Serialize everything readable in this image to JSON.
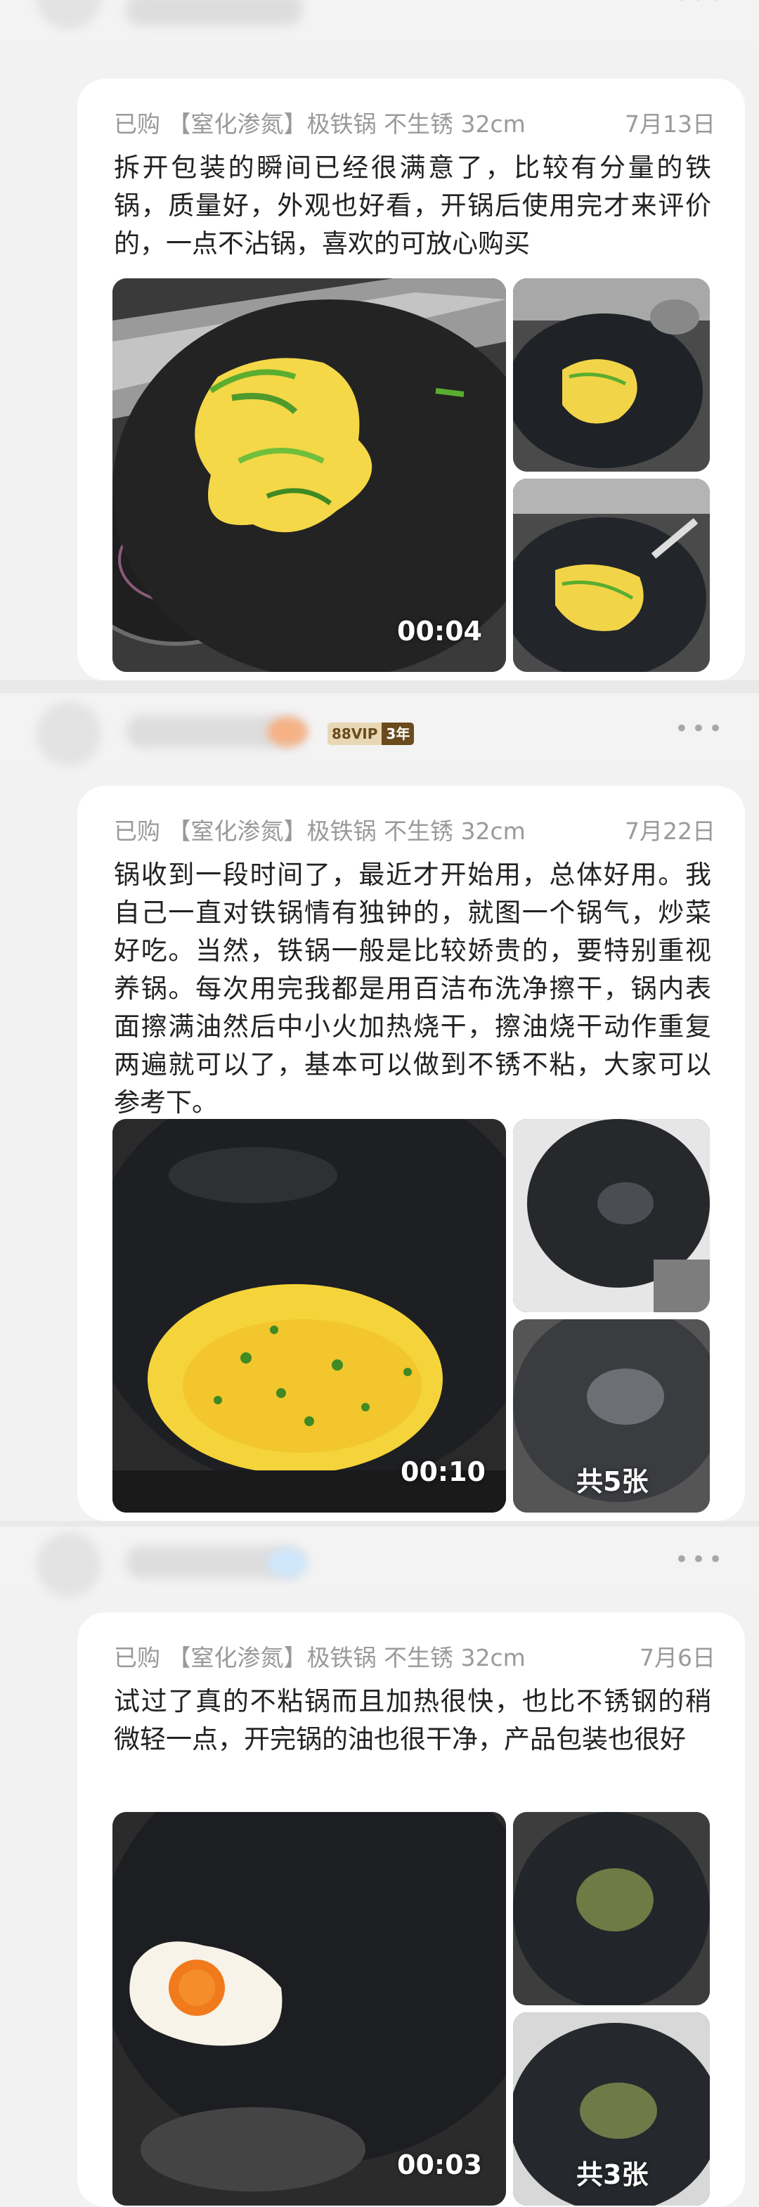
{
  "reviews": [
    {
      "purchase": "已购 【窒化渗氮】极铁锅 不生锈 32cm",
      "date": "7月13日",
      "text": "拆开包装的瞬间已经很满意了，比较有分量的铁锅，质量好，外观也好看，开锅后使用完才来评价的，一点不沾锅，喜欢的可放心购买",
      "video_duration": "00:04"
    },
    {
      "user_badge_vip": "88VIP",
      "user_badge_years": "3年",
      "purchase": "已购 【窒化渗氮】极铁锅 不生锈 32cm",
      "date": "7月22日",
      "text": "锅收到一段时间了，最近才开始用，总体好用。我自己一直对铁锅情有独钟的，就图一个锅气，炒菜好吃。当然，铁锅一般是比较娇贵的，要特别重视养锅。每次用完我都是用百洁布洗净擦干，锅内表面擦满油然后中小火加热烧干，擦油烧干动作重复两遍就可以了，基本可以做到不锈不粘，大家可以参考下。",
      "video_duration": "00:10",
      "photo_count": "共5张"
    },
    {
      "purchase": "已购 【窒化渗氮】极铁锅 不生锈 32cm",
      "date": "7月6日",
      "text": "试过了真的不粘锅而且加热很快，也比不锈钢的稍微轻一点，开完锅的油也很干净，产品包装也很好",
      "video_duration": "00:03",
      "photo_count": "共3张"
    }
  ],
  "icons": {
    "more": "more-dots-icon",
    "play": "video-thumbnail"
  },
  "colors": {
    "meta_gray": "#9a9a9a",
    "vip_gold": "#e8d7b4",
    "vip_brown": "#6a4b1d"
  }
}
